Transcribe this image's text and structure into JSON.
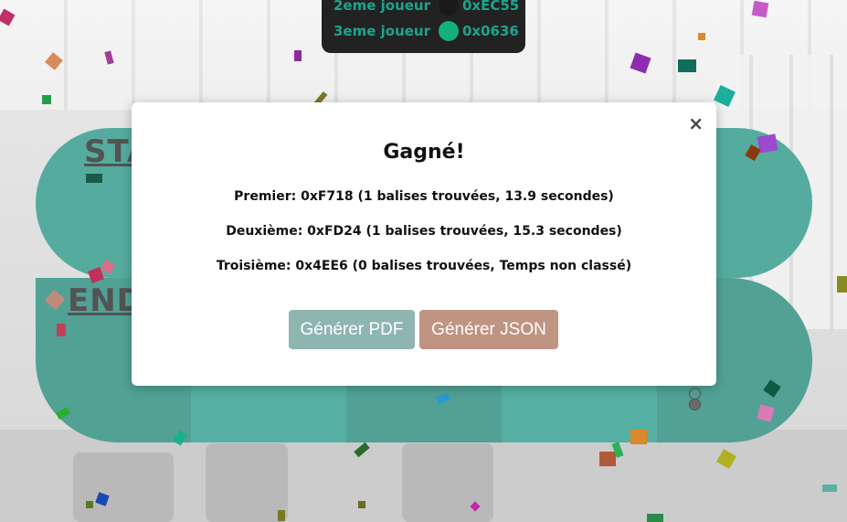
{
  "scoreboard": {
    "rows": [
      {
        "label": "2eme joueur",
        "address": "0xEC55",
        "dot_color": "#1a1a1a"
      },
      {
        "label": "3eme joueur",
        "address": "0x0636",
        "dot_color": "#14b07a"
      }
    ]
  },
  "board": {
    "start_label": "STA",
    "end_label": "END",
    "colors": {
      "top": "#168b7a",
      "bottom": "#0f7d6d",
      "stripe": "#14917f"
    }
  },
  "modal": {
    "close_symbol": "×",
    "title": "Gagné!",
    "results": [
      "Premier: 0xF718 (1 balises trouvées, 13.9 secondes)",
      "Deuxième: 0xFD24 (1 balises trouvées, 15.3 secondes)",
      "Troisième: 0x4EE6 (0 balises trouvées, Temps non classé)"
    ],
    "buttons": {
      "pdf_label": "Générer PDF",
      "json_label": "Générer JSON"
    }
  }
}
